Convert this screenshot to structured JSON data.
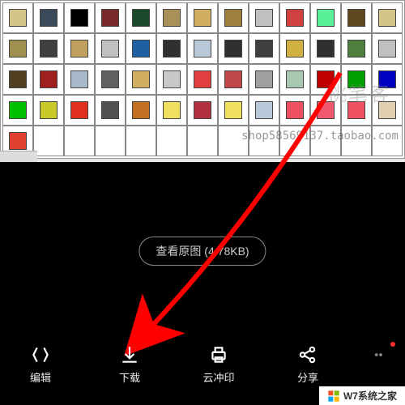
{
  "viewer": {
    "view_original_label": "查看原图 (",
    "file_size": "4.78KB",
    "close_paren": ")"
  },
  "watermarks": {
    "shop": "shop58569137.taobao.com",
    "brand": "桃笔客"
  },
  "bottom_bar": {
    "items": [
      {
        "label": "编辑"
      },
      {
        "label": "下载"
      },
      {
        "label": "云冲印"
      },
      {
        "label": "分享"
      }
    ]
  },
  "footer": {
    "site_name": "W7系统之家"
  },
  "swatches": {
    "row0": [
      "#d4c48a",
      "#3a4a5a",
      "#000",
      "#7a2a2a",
      "#1a4a2a",
      "#a89058",
      "#d0b060",
      "#a08040",
      "#c0c0c0",
      "#d04040",
      "#5af098",
      "#604820",
      "#d4c48a"
    ],
    "row1": [
      "#a09050",
      "#404040",
      "#c0a060",
      "#c0c0c0",
      "#2060a0",
      "#303030",
      "#b8c8d8",
      "#303030",
      "#404040",
      "#d0b040",
      "#303030",
      "#508040",
      "#c0c0c0"
    ],
    "row2": [
      "#504020",
      "#a02020",
      "#a8b8c8",
      "#606060",
      "#d0b060",
      "#c8c8c8",
      "#e04040",
      "#c04848",
      "#a0a0a0",
      "#a8c8b0",
      "#c00000",
      "#00a000",
      "#0000c0"
    ],
    "row3": [
      "#00c000",
      "#c8c828",
      "#e03020",
      "#505050",
      "#c07020",
      "#f0e060",
      "#b03040",
      "#f0e060",
      "#b8c8d8",
      "#f05060",
      "#f05870",
      "#f05060",
      "#e0d0b0"
    ],
    "row4": [
      "#e04030"
    ]
  }
}
